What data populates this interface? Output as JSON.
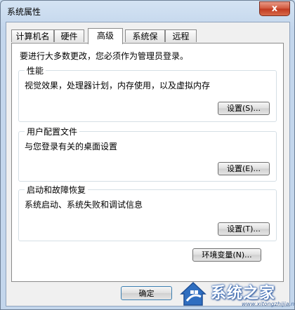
{
  "window": {
    "title": "系统属性",
    "close_glyph": "x"
  },
  "tabs": [
    {
      "label": "计算机名",
      "active": false
    },
    {
      "label": "硬件",
      "active": false
    },
    {
      "label": "高级",
      "active": true
    },
    {
      "label": "系统保护",
      "active": false
    },
    {
      "label": "远程",
      "active": false
    }
  ],
  "advanced": {
    "admin_note": "要进行大多数更改，您必须作为管理员登录。",
    "performance": {
      "title": "性能",
      "description": "视觉效果，处理器计划，内存使用，以及虚拟内存",
      "button": "设置(S)..."
    },
    "user_profiles": {
      "title": "用户配置文件",
      "description": "与您登录有关的桌面设置",
      "button": "设置(E)..."
    },
    "startup_recovery": {
      "title": "启动和故障恢复",
      "description": "系统启动、系统失败和调试信息",
      "button": "设置(T)..."
    },
    "env_button": "环境变量(N)..."
  },
  "footer": {
    "ok_button": "确定"
  },
  "watermark": {
    "text": "系统之家",
    "url": "www.xitongzhijia.net"
  },
  "colors": {
    "title_bar": "#c3d6ec",
    "close_button": "#c9482d",
    "panel": "#ffffff",
    "watermark_blue": "#2f6ec0"
  }
}
